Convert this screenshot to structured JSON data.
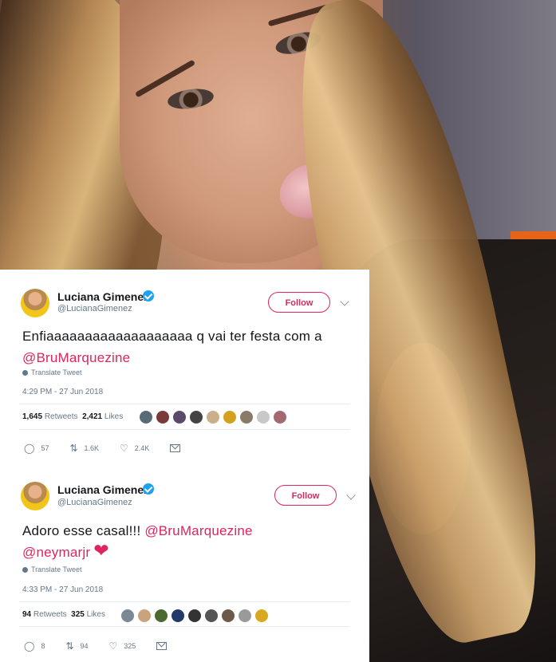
{
  "tweets": [
    {
      "name": "Luciana Gimenez",
      "handle": "@LucianaGimenez",
      "follow_label": "Follow",
      "text_before": "Enfiaaaaaaaaaaaaaaaaaaa q vai ter festa com a ",
      "mentions": [
        "@BruMarquezine"
      ],
      "translate_label": "Translate Tweet",
      "timestamp": "4:29 PM - 27 Jun 2018",
      "retweets": "1,645",
      "retweets_label": "Retweets",
      "likes": "2,421",
      "likes_label": "Likes",
      "actions": {
        "replies": "57",
        "retweets": "1.6K",
        "likes": "2.4K"
      }
    },
    {
      "name": "Luciana Gimenez",
      "handle": "@LucianaGimenez",
      "follow_label": "Follow",
      "text_before": "Adoro esse casal!!! ",
      "mentions": [
        "@BruMarquezine",
        "@neymarjr"
      ],
      "translate_label": "Translate Tweet",
      "timestamp": "4:33 PM - 27 Jun 2018",
      "retweets": "94",
      "retweets_label": "Retweets",
      "likes": "325",
      "likes_label": "Likes",
      "actions": {
        "replies": "8",
        "retweets": "94",
        "likes": "325"
      }
    }
  ],
  "icons": {
    "verified": "verified-badge-icon",
    "reply": "reply-icon",
    "retweet": "retweet-icon",
    "like": "heart-icon",
    "dm": "mail-icon",
    "more": "chevron-down-icon",
    "translate": "globe-icon",
    "emoji_heart": "red-heart-emoji"
  },
  "colors": {
    "accent": "#e0245e",
    "verified": "#1da1f2",
    "muted": "#657786"
  }
}
